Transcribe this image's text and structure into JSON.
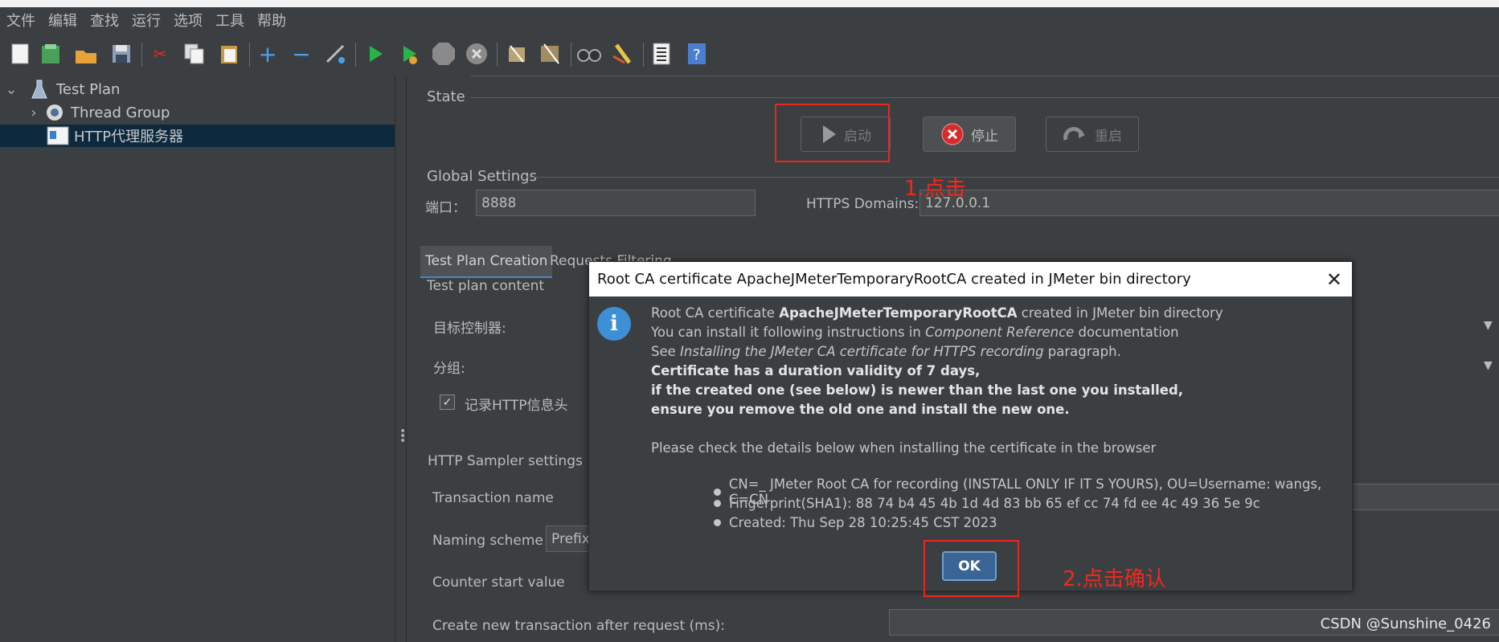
{
  "menu": [
    "文件",
    "编辑",
    "查找",
    "运行",
    "选项",
    "工具",
    "帮助"
  ],
  "tree": {
    "items": [
      {
        "label": "Test Plan"
      },
      {
        "label": "Thread Group"
      },
      {
        "label": "HTTP代理服务器"
      }
    ]
  },
  "state": {
    "title": "State",
    "start_label": "启动",
    "stop_label": "停止",
    "restart_label": "重启"
  },
  "global": {
    "title": "Global Settings",
    "port_label": "端口：",
    "port_value": "8888",
    "https_label": "HTTPS Domains:",
    "https_value": "127.0.0.1"
  },
  "tabs": [
    "Test Plan Creation",
    "Requests Filtering"
  ],
  "content": {
    "title": "Test plan content",
    "target_label": "目标控制器:",
    "group_label": "分组:",
    "record_headers_label": "记录HTTP信息头",
    "sampler_title": "HTTP Sampler settings",
    "transaction_name_label": "Transaction name",
    "naming_scheme_label": "Naming scheme",
    "naming_scheme_value": "Prefix",
    "counter_label": "Counter start value",
    "create_tx_label": "Create new transaction after request (ms):"
  },
  "dialog": {
    "title": "Root CA certificate ApacheJMeterTemporaryRootCA created in JMeter bin directory",
    "line1_pre": "Root CA certificate ",
    "line1_bold": "ApacheJMeterTemporaryRootCA",
    "line1_post": " created in JMeter bin directory",
    "line2_pre": "You can install it following instructions in ",
    "line2_italic": "Component Reference",
    "line2_post": " documentation",
    "line3_pre": "See ",
    "line3_italic": "Installing the JMeter CA certificate for HTTPS recording",
    "line3_post": " paragraph.",
    "bold1": "Certificate has a duration validity of 7 days,",
    "bold2": "if the created one (see below) is newer than the last one you installed,",
    "bold3": "ensure you remove the old one and install the new one.",
    "check_line": "Please check the details below when installing the certificate in the browser",
    "bullets": [
      "CN=_ JMeter Root CA for recording (INSTALL ONLY IF IT S YOURS), OU=Username: wangs, C=CN",
      "Fingerprint(SHA1): 88 74 b4 45 4b 1d 4d 83 bb 65 ef cc 74 fd ee 4c 49 36 5e 9c",
      "Created: Thu Sep 28 10:25:45 CST 2023"
    ],
    "ok_label": "OK"
  },
  "annotations": {
    "step1": "1.点击",
    "step2": "2.点击确认"
  },
  "watermark": "CSDN @Sunshine_0426",
  "colors": {
    "background": "#3c3f41",
    "selection": "#0d293e",
    "annotation_red": "#e8261f",
    "ok_button": "#3a6494"
  }
}
